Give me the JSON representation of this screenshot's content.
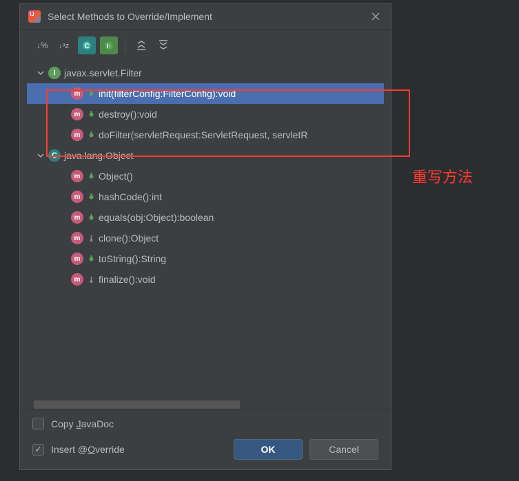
{
  "dialog": {
    "title": "Select Methods to Override/Implement"
  },
  "tree": {
    "groups": [
      {
        "icon": "I",
        "iconType": "interface",
        "label": "javax.servlet.Filter",
        "methods": [
          {
            "vis": "public",
            "label": "init(filterConfig:FilterConfig):void",
            "selected": true
          },
          {
            "vis": "public",
            "label": "destroy():void"
          },
          {
            "vis": "public",
            "label": "doFilter(servletRequest:ServletRequest, servletR"
          }
        ]
      },
      {
        "icon": "C",
        "iconType": "class",
        "label": "java.lang.Object",
        "methods": [
          {
            "vis": "public",
            "label": "Object()"
          },
          {
            "vis": "public",
            "label": "hashCode():int"
          },
          {
            "vis": "public",
            "label": "equals(obj:Object):boolean"
          },
          {
            "vis": "protected",
            "label": "clone():Object"
          },
          {
            "vis": "public",
            "label": "toString():String"
          },
          {
            "vis": "protected",
            "label": "finalize():void"
          }
        ]
      }
    ]
  },
  "checkboxes": {
    "copyJavaDoc": {
      "prefix": "Copy ",
      "mnemonic": "J",
      "suffix": "avaDoc",
      "checked": false
    },
    "insertOverride": {
      "prefix": "Insert @",
      "mnemonic": "O",
      "suffix": "verride",
      "checked": true
    }
  },
  "buttons": {
    "ok": "OK",
    "cancel": "Cancel"
  },
  "annotation": "重写方法"
}
